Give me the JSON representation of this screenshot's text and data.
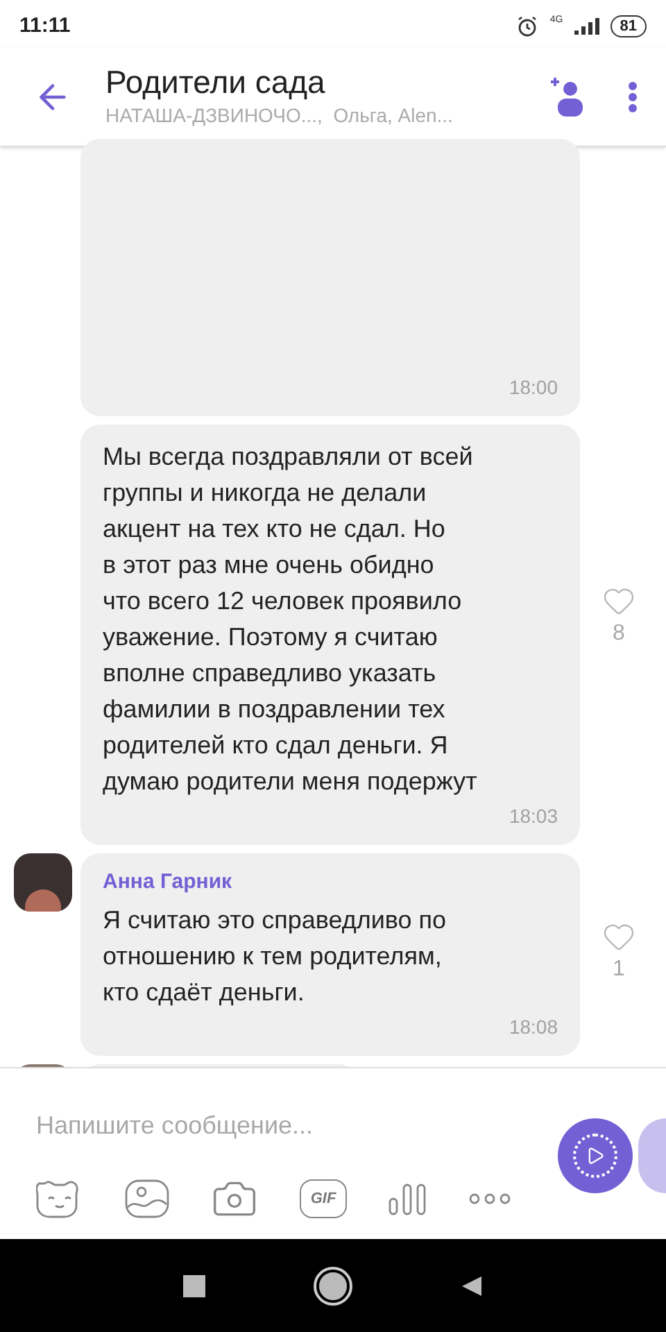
{
  "status_bar": {
    "time": "11:11",
    "network": "4G",
    "battery": "81"
  },
  "header": {
    "title": "Родители сада",
    "subtitle": "НАТАША-ДЗВИНОЧО...,  Ольга, Alen..."
  },
  "messages": [
    {
      "kind": "cropped",
      "time": "18:00"
    },
    {
      "kind": "own",
      "text": "Мы всегда поздравляли от всей\nгруппы и никогда не делали\nакцент на тех кто не сдал. Но\nв этот раз мне очень обидно\nчто всего 12 человек проявило\nуважение. Поэтому я считаю\nвполне справедливо  указать\nфамилии в поздравлении тех\nродителей кто сдал деньги. Я\nдумаю родители меня подержут",
      "time": "18:03",
      "likes": "8"
    },
    {
      "kind": "other",
      "sender": "Анна Гарник",
      "text": "Я считаю это справедливо по\nотношению к тем родителям,\nкто сдаёт деньги.",
      "time": "18:08",
      "likes": "1"
    },
    {
      "kind": "partial"
    }
  ],
  "composer": {
    "placeholder": "Напишите сообщение...",
    "gif_label": "GIF"
  }
}
